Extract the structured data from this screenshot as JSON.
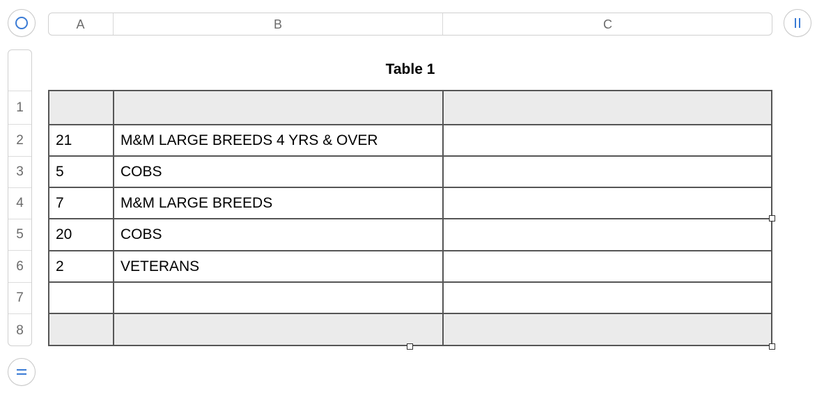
{
  "table": {
    "title": "Table 1",
    "columns": [
      "A",
      "B",
      "C"
    ],
    "row_numbers": [
      "1",
      "2",
      "3",
      "4",
      "5",
      "6",
      "7",
      "8"
    ],
    "rows": [
      [
        "",
        "",
        ""
      ],
      [
        "21",
        "M&M LARGE BREEDS 4 YRS & OVER",
        ""
      ],
      [
        "5",
        "COBS",
        ""
      ],
      [
        "7",
        "M&M LARGE BREEDS",
        ""
      ],
      [
        "20",
        "COBS",
        ""
      ],
      [
        "2",
        "VETERANS",
        ""
      ],
      [
        "",
        "",
        ""
      ],
      [
        "",
        "",
        ""
      ]
    ]
  },
  "controls": {
    "select_all_icon": "circle-icon",
    "add_columns_icon": "pause-bars-icon",
    "add_rows_icon": "equals-icon"
  },
  "colors": {
    "accent": "#3a7bd5",
    "header_fill": "#ebebeb",
    "grid_line": "#555555"
  }
}
